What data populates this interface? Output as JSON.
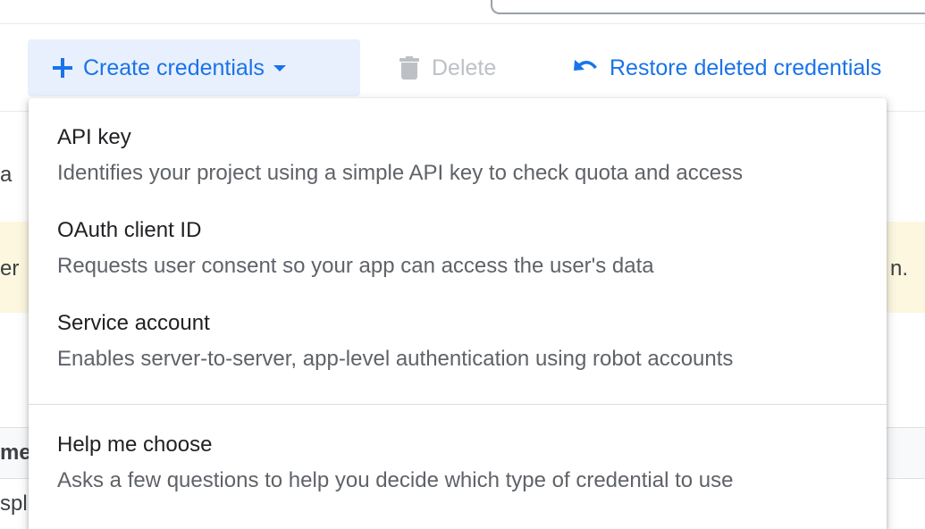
{
  "toolbar": {
    "create_label": "Create credentials",
    "delete_label": "Delete",
    "restore_label": "Restore deleted credentials"
  },
  "background": {
    "frag_1": "a",
    "frag_2": "er",
    "frag_3": "n.",
    "frag_4": "me",
    "frag_5": "spl"
  },
  "menu": {
    "items": [
      {
        "title": "API key",
        "description": "Identifies your project using a simple API key to check quota and access"
      },
      {
        "title": "OAuth client ID",
        "description": "Requests user consent so your app can access the user's data"
      },
      {
        "title": "Service account",
        "description": "Enables server-to-server, app-level authentication using robot accounts"
      },
      {
        "title": "Help me choose",
        "description": "Asks a few questions to help you decide which type of credential to use"
      }
    ]
  },
  "colors": {
    "accent": "#1a73e8",
    "button_bg": "#e8f0fe",
    "disabled": "#bdc1c6",
    "warning_bg": "#fef7e0"
  },
  "icons": {
    "create": "plus-icon",
    "caret": "caret-down-icon",
    "delete": "trash-icon",
    "restore": "undo-icon"
  }
}
